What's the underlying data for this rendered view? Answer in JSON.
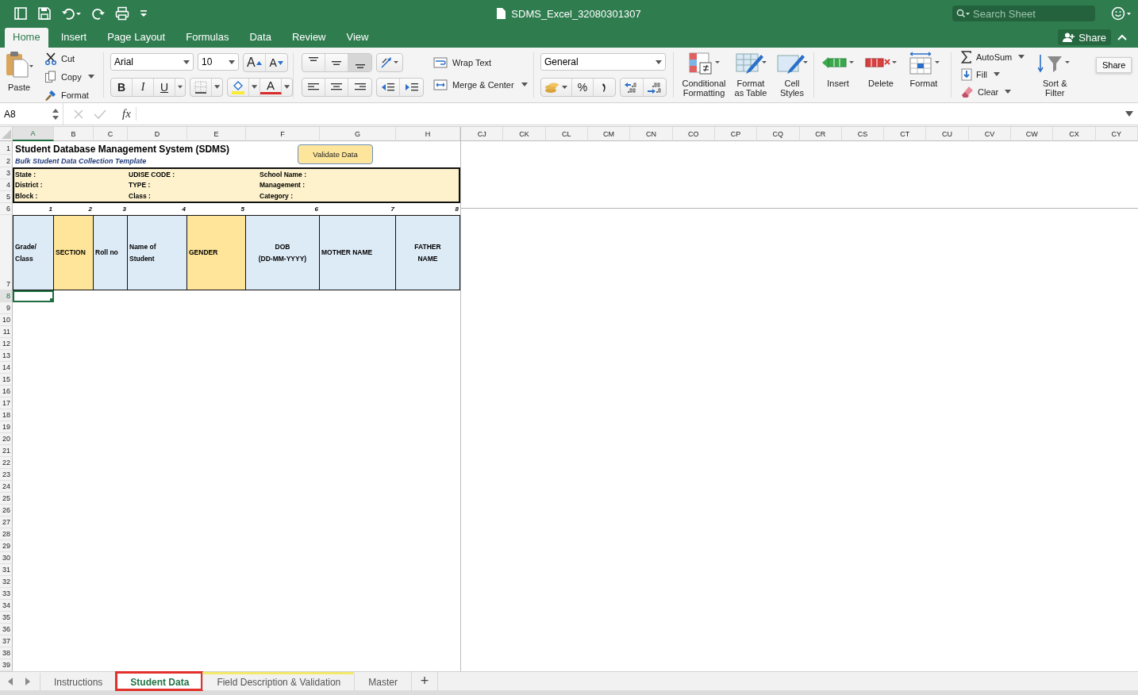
{
  "title_bar": {
    "file_name": "SDMS_Excel_32080301307",
    "search": {
      "placeholder": "Search Sheet"
    }
  },
  "ribbon_tabs": [
    {
      "label": "Home",
      "selected": true
    },
    {
      "label": "Insert",
      "selected": false
    },
    {
      "label": "Page Layout",
      "selected": false
    },
    {
      "label": "Formulas",
      "selected": false
    },
    {
      "label": "Data",
      "selected": false
    },
    {
      "label": "Review",
      "selected": false
    },
    {
      "label": "View",
      "selected": false
    }
  ],
  "share_button": "Share",
  "clipboard": {
    "paste": "Paste",
    "cut": "Cut",
    "copy": "Copy",
    "format_painter": "Format"
  },
  "font": {
    "name": "Arial",
    "size": "10",
    "grow": "A",
    "shrink": "A",
    "bold": "B",
    "italic": "I",
    "underline": "U",
    "font_color": "A"
  },
  "alignment": {
    "vertical": [
      {
        "selected": false
      },
      {
        "selected": false
      },
      {
        "selected": true
      }
    ],
    "wrap_text": "Wrap Text",
    "merge_center": "Merge & Center"
  },
  "number": {
    "format": "General",
    "percent": "%"
  },
  "styles": [
    {
      "kind": "conditional",
      "label": "Conditional Formatting"
    },
    {
      "kind": "table",
      "label": "Format as Table"
    },
    {
      "kind": "cell",
      "label": "Cell Styles"
    }
  ],
  "cells": [
    {
      "kind": "insert",
      "label": "Insert"
    },
    {
      "kind": "delete",
      "label": "Delete"
    },
    {
      "kind": "format",
      "label": "Format"
    }
  ],
  "editing": {
    "autosum": "AutoSum",
    "fill": "Fill",
    "clear": "Clear",
    "sort_filter": "Sort & Filter"
  },
  "tooltip": "Share",
  "formula_bar": {
    "name_box": "A8",
    "fx": "fx"
  },
  "columns_left": [
    {
      "label": "A",
      "selected": true
    },
    {
      "label": "B",
      "selected": false
    },
    {
      "label": "C",
      "selected": false
    },
    {
      "label": "D",
      "selected": false
    },
    {
      "label": "E",
      "selected": false
    },
    {
      "label": "F",
      "selected": false
    },
    {
      "label": "G",
      "selected": false
    },
    {
      "label": "H",
      "selected": false
    }
  ],
  "columns_right": [
    "CJ",
    "CK",
    "CL",
    "CM",
    "CN",
    "CO",
    "CP",
    "CQ",
    "CR",
    "CS",
    "CT",
    "CU",
    "CV",
    "CW",
    "CX",
    "CY"
  ],
  "rows": [
    {
      "label": "1",
      "selected": false
    },
    {
      "label": "2",
      "selected": false
    },
    {
      "label": "3",
      "selected": false
    },
    {
      "label": "4",
      "selected": false
    },
    {
      "label": "5",
      "selected": false
    },
    {
      "label": "6",
      "selected": false
    },
    {
      "label": "7",
      "selected": false
    },
    {
      "label": "8",
      "selected": true
    },
    {
      "label": "9",
      "selected": false
    },
    {
      "label": "10",
      "selected": false
    },
    {
      "label": "11",
      "selected": false
    },
    {
      "label": "12",
      "selected": false
    },
    {
      "label": "13",
      "selected": false
    },
    {
      "label": "14",
      "selected": false
    },
    {
      "label": "15",
      "selected": false
    },
    {
      "label": "16",
      "selected": false
    },
    {
      "label": "17",
      "selected": false
    },
    {
      "label": "18",
      "selected": false
    },
    {
      "label": "19",
      "selected": false
    },
    {
      "label": "20",
      "selected": false
    },
    {
      "label": "21",
      "selected": false
    },
    {
      "label": "22",
      "selected": false
    },
    {
      "label": "23",
      "selected": false
    },
    {
      "label": "24",
      "selected": false
    },
    {
      "label": "25",
      "selected": false
    },
    {
      "label": "26",
      "selected": false
    },
    {
      "label": "27",
      "selected": false
    },
    {
      "label": "28",
      "selected": false
    },
    {
      "label": "29",
      "selected": false
    },
    {
      "label": "30",
      "selected": false
    },
    {
      "label": "31",
      "selected": false
    },
    {
      "label": "32",
      "selected": false
    },
    {
      "label": "33",
      "selected": false
    },
    {
      "label": "34",
      "selected": false
    },
    {
      "label": "35",
      "selected": false
    },
    {
      "label": "36",
      "selected": false
    },
    {
      "label": "37",
      "selected": false
    },
    {
      "label": "38",
      "selected": false
    },
    {
      "label": "39",
      "selected": false
    }
  ],
  "sheet": {
    "title": "Student Database Management System (SDMS)",
    "subtitle": "Bulk Student Data Collection Template",
    "validate_button": "Validate Data",
    "info": [
      [
        "State :",
        "UDISE CODE :",
        "School Name :"
      ],
      [
        "District :",
        "TYPE :",
        "Management :"
      ],
      [
        "Block :",
        "Class :",
        "Category :"
      ]
    ],
    "field_numbers": [
      "1",
      "2",
      "3",
      "4",
      "5",
      "6",
      "7",
      "8"
    ],
    "headers": [
      {
        "label": "Grade/\nClass",
        "color": "#ddebf7",
        "centered": false
      },
      {
        "label": "SECTION",
        "color": "#fee599",
        "centered": false
      },
      {
        "label": "Roll no",
        "color": "#ddebf7",
        "centered": false
      },
      {
        "label": "Name of\nStudent",
        "color": "#ddebf7",
        "centered": false
      },
      {
        "label": "GENDER",
        "color": "#fee599",
        "centered": false
      },
      {
        "label": "DOB\n(DD-MM-YYYY)",
        "color": "#ddebf7",
        "centered": true
      },
      {
        "label": "MOTHER  NAME",
        "color": "#ddebf7",
        "centered": false
      },
      {
        "label": "FATHER\nNAME",
        "color": "#ddebf7",
        "centered": true
      }
    ]
  },
  "sheet_tabs": [
    {
      "label": "Instructions",
      "selected": false,
      "highlighted": false
    },
    {
      "label": "Student Data",
      "selected": true,
      "highlighted": true
    },
    {
      "label": "Field Description & Validation",
      "selected": false,
      "highlighted": false,
      "color": "#f3e96c"
    },
    {
      "label": "Master",
      "selected": false,
      "highlighted": false
    }
  ],
  "add_sheet": "+"
}
